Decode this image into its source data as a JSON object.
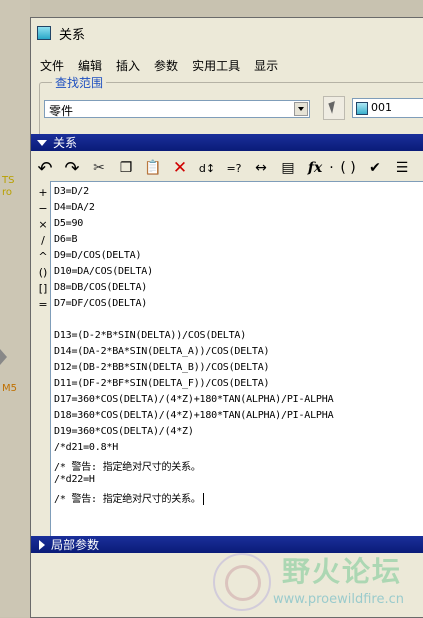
{
  "window": {
    "title": "关系"
  },
  "menu": [
    "文件",
    "编辑",
    "插入",
    "参数",
    "实用工具",
    "显示"
  ],
  "scope": {
    "title": "查找范围",
    "type_value": "零件",
    "model_value": "001"
  },
  "relations_section": {
    "label": "关系"
  },
  "toolbar_icons": [
    "undo-icon",
    "redo-icon",
    "cut-icon",
    "copy-icon",
    "paste-icon",
    "delete-icon",
    "sort-icon",
    "evaluate-icon",
    "dimension-icon",
    "unit-icon",
    "function-icon",
    "parentheses-icon",
    "verify-icon",
    "list-icon"
  ],
  "operators": [
    "+",
    "−",
    "×",
    "/",
    "^",
    "()",
    "[]",
    "="
  ],
  "relations": [
    "D3=D/2",
    "D4=DA/2",
    "D5=90",
    "D6=B",
    "D9=D/COS(DELTA)",
    "D10=DA/COS(DELTA)",
    "D8=DB/COS(DELTA)",
    "D7=DF/COS(DELTA)",
    "",
    "D13=(D-2*B*SIN(DELTA))/COS(DELTA)",
    "D14=(DA-2*BA*SIN(DELTA_A))/COS(DELTA)",
    "D12=(DB-2*BB*SIN(DELTA_B))/COS(DELTA)",
    "D11=(DF-2*BF*SIN(DELTA_F))/COS(DELTA)",
    "D17=360*COS(DELTA)/(4*Z)+180*TAN(ALPHA)/PI-ALPHA",
    "D18=360*COS(DELTA)/(4*Z)+180*TAN(ALPHA)/PI-ALPHA",
    "D19=360*COS(DELTA)/(4*Z)",
    "/*d21=0.8*H",
    "/* 警告: 指定绝对尺寸的关系。",
    "/*d22=H",
    "/* 警告: 指定绝对尺寸的关系。"
  ],
  "local_params_section": {
    "label": "局部参数"
  },
  "background": {
    "label_a": "TS",
    "label_b": "ro",
    "label_m5": "M5"
  },
  "watermark": {
    "title": "野火论坛",
    "url": "www.proewildfire.cn"
  }
}
